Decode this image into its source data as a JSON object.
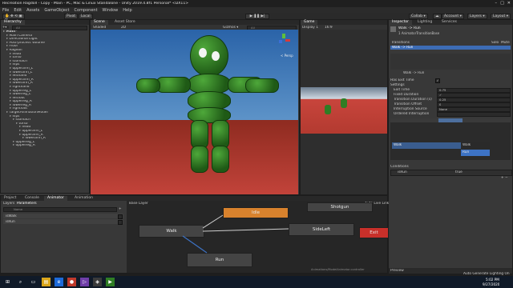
{
  "window": {
    "title": "Recreation Ragdoll - Copy - Main - PC, Mac & Linux Standalone - Unity 2019.4.8f1 Personal* <DX11>"
  },
  "menu": [
    "File",
    "Edit",
    "Assets",
    "GameObject",
    "Component",
    "Window",
    "Help"
  ],
  "toolbar": {
    "pivot": "Pivot",
    "local": "Local",
    "collab": "Collab ▾",
    "account": "Account ▾",
    "layers": "Layers ▾",
    "layout": "Layout ▾"
  },
  "hierarchy": {
    "tab": "Hierarchy",
    "search_placeholder": "All",
    "items": [
      {
        "label": "Main*",
        "depth": 0,
        "bold": true
      },
      {
        "label": "Main Camera",
        "depth": 1
      },
      {
        "label": "Directional Light",
        "depth": 1
      },
      {
        "label": "Post-process Volume",
        "depth": 1
      },
      {
        "label": "Floor",
        "depth": 1
      },
      {
        "label": "Ragdoll",
        "depth": 1
      },
      {
        "label": "head",
        "depth": 2
      },
      {
        "label": "torso",
        "depth": 2
      },
      {
        "label": "stomach",
        "depth": 2
      },
      {
        "label": "hips",
        "depth": 2
      },
      {
        "label": "upperarm_L",
        "depth": 2
      },
      {
        "label": "lowerarm_L",
        "depth": 2
      },
      {
        "label": "lefthand",
        "depth": 2
      },
      {
        "label": "upperarm_R",
        "depth": 2
      },
      {
        "label": "lowerarm_R",
        "depth": 2
      },
      {
        "label": "righthand",
        "depth": 2
      },
      {
        "label": "upperleg_L",
        "depth": 2
      },
      {
        "label": "lowerleg_L",
        "depth": 2
      },
      {
        "label": "leftfoot",
        "depth": 2
      },
      {
        "label": "upperleg_R",
        "depth": 2
      },
      {
        "label": "lowerleg_R",
        "depth": 2
      },
      {
        "label": "rightfoot",
        "depth": 2
      },
      {
        "label": "TargetAnimationModel",
        "depth": 1
      },
      {
        "label": "hips",
        "depth": 2
      },
      {
        "label": "stomach",
        "depth": 3
      },
      {
        "label": "torso",
        "depth": 4
      },
      {
        "label": "head",
        "depth": 5
      },
      {
        "label": "upperarm_L",
        "depth": 5
      },
      {
        "label": "upperarm_R",
        "depth": 5
      },
      {
        "label": "lowerarm_R",
        "depth": 6
      },
      {
        "label": "upperleg_L",
        "depth": 3
      },
      {
        "label": "upperleg_R",
        "depth": 3
      }
    ]
  },
  "scene": {
    "tab": "Scene",
    "asset_store_tab": "Asset Store",
    "shading": "Shaded",
    "mode": "2D",
    "gizmos": "Gizmos ▾",
    "search_placeholder": "All",
    "persp": "< Persp"
  },
  "game": {
    "tab": "Game",
    "display": "Display 1",
    "aspect": "16:9"
  },
  "inspector": {
    "tabs": [
      "Inspector",
      "Lighting",
      "Services"
    ],
    "title": "Walk -> Run",
    "subtitle": "1 AnimatorTransitionBase",
    "transitions_label": "Transitions",
    "solo": "Solo",
    "mute": "Mute",
    "transition_row": "Walk -> Run",
    "preview_label": "Walk -> Run",
    "has_exit_time": "Has Exit Time",
    "settings": "Settings",
    "fields": [
      {
        "label": "Exit Time",
        "value": "0.75"
      },
      {
        "label": "Fixed Duration",
        "value": "✓"
      },
      {
        "label": "Transition Duration (s)",
        "value": "0.25"
      },
      {
        "label": "Transition Offset",
        "value": "0"
      },
      {
        "label": "Interruption Source",
        "value": "None"
      },
      {
        "label": "Ordered Interruption",
        "value": ""
      }
    ],
    "timeline_left": "Walk",
    "timeline_right": "Walk",
    "timeline_run": "Run",
    "conditions": "Conditions",
    "condition_param": "isRun",
    "condition_value": "true",
    "preview": "Preview"
  },
  "bottom": {
    "tabs": [
      "Project",
      "Console",
      "Animator",
      "Animation"
    ],
    "layers_tab": "Layers",
    "params_tab": "Parameters",
    "search_placeholder": "Name",
    "params": [
      {
        "name": "isWalk"
      },
      {
        "name": "isRun"
      }
    ],
    "breadcrumb": "Base Layer",
    "auto_live": "Auto Live Link",
    "nodes": {
      "idle": "Idle",
      "walk": "Walk",
      "sidestep": "SideLeft",
      "run": "Run",
      "jump": "Shotgun",
      "exit": "Exit"
    },
    "path": "Animations/ModelAnimator.controller"
  },
  "status": {
    "right": "Auto Generate Lighting On"
  },
  "taskbar": {
    "time": "5:02 PM",
    "date": "9/27/2020"
  },
  "colors": {
    "accent": "#3d73c5",
    "orange": "#d8822d",
    "red": "#c8302a",
    "green": "#2f7d24"
  }
}
